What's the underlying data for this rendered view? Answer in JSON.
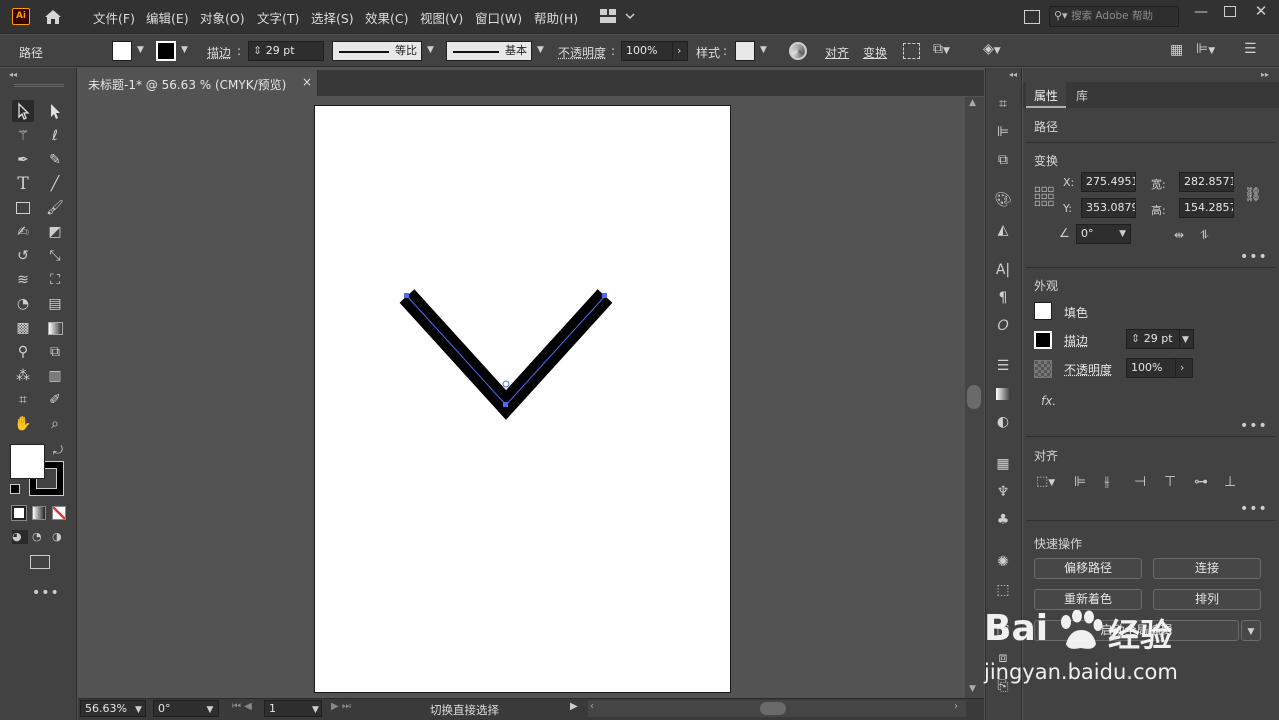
{
  "app": {
    "logo": "Ai"
  },
  "menu": {
    "items": [
      "文件(F)",
      "编辑(E)",
      "对象(O)",
      "文字(T)",
      "选择(S)",
      "效果(C)",
      "视图(V)",
      "窗口(W)",
      "帮助(H)"
    ]
  },
  "search": {
    "placeholder": "搜索 Adobe 帮助"
  },
  "control_bar": {
    "object_type": "路径",
    "stroke_label": "描边",
    "stroke_weight": "29 pt",
    "profile_label": "等比",
    "brush_label": "基本",
    "opacity_label": "不透明度",
    "opacity_value": "100%",
    "style_label": "样式",
    "align_label": "对齐",
    "transform_label": "变换"
  },
  "document": {
    "tab_title": "未标题-1* @ 56.63 % (CMYK/预览)",
    "close_glyph": "×"
  },
  "status": {
    "zoom": "56.63%",
    "rotation": "0°",
    "artboard_num": "1",
    "tool_hint": "切换直接选择"
  },
  "properties_panel": {
    "tabs": [
      "属性",
      "库"
    ],
    "selection_type": "路径",
    "transform": {
      "title": "变换",
      "x_label": "X:",
      "x": "275.4951",
      "y_label": "Y:",
      "y": "353.0879",
      "w_label": "宽:",
      "w": "282.8571",
      "h_label": "高:",
      "h": "154.2857",
      "angle": "0°"
    },
    "appearance": {
      "title": "外观",
      "fill_label": "填色",
      "stroke_label": "描边",
      "stroke_weight": "29 pt",
      "opacity_label": "不透明度",
      "opacity": "100%",
      "fx_label": "fx."
    },
    "align": {
      "title": "对齐"
    },
    "quick_actions": {
      "title": "快速操作",
      "buttons": [
        "偏移路径",
        "连接",
        "重新着色",
        "排列",
        "启动全局编辑"
      ]
    }
  },
  "watermark": {
    "brand_left": "Bai",
    "brand_right": "经验",
    "url": "jingyan.baidu.com"
  },
  "colors": {
    "accent_path": "#4a6cf7",
    "ui_dark": "#323232",
    "panel": "#424242",
    "canvas": "#535353"
  }
}
